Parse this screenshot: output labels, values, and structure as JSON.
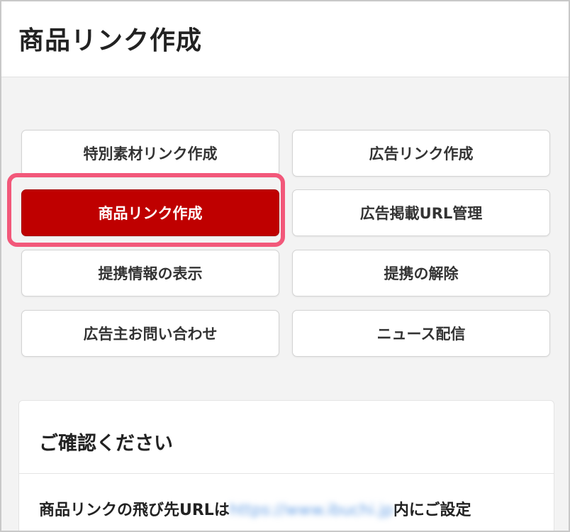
{
  "header": {
    "title": "商品リンク作成"
  },
  "menu": {
    "buttons": [
      {
        "label": "特別素材リンク作成"
      },
      {
        "label": "広告リンク作成"
      },
      {
        "label": "商品リンク作成"
      },
      {
        "label": "広告掲載URL管理"
      },
      {
        "label": "提携情報の表示"
      },
      {
        "label": "提携の解除"
      },
      {
        "label": "広告主お問い合わせ"
      },
      {
        "label": "ニュース配信"
      }
    ],
    "active_index": 2
  },
  "notice": {
    "title": "ご確認ください",
    "body_prefix": "商品リンクの飛び先URLは",
    "body_url": "https://www.ibuchi.jp",
    "body_suffix": "内にご設定"
  },
  "colors": {
    "active_button": "#bf0000",
    "highlight_ring": "#f2587a",
    "background": "#f3f3f3"
  }
}
